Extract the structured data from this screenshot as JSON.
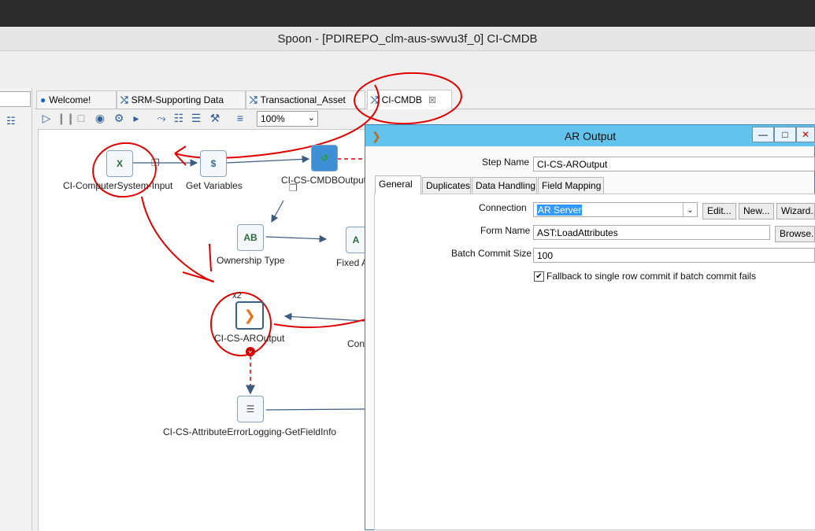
{
  "window": {
    "title": "Spoon - [PDIREPO_clm-aus-swvu3f_0] CI-CMDB"
  },
  "tabs": [
    {
      "label": "Welcome!",
      "active": false
    },
    {
      "label": "SRM-Supporting Data",
      "active": false
    },
    {
      "label": "Transactional_Asset",
      "active": false
    },
    {
      "label": "CI-CMDB",
      "active": true
    }
  ],
  "toolbar": {
    "zoom": "100%"
  },
  "nodes": {
    "input": {
      "label": "CI-ComputerSystem-Input",
      "icon": "excel-input-icon"
    },
    "getvars": {
      "label": "Get Variables",
      "icon": "dollar-icon"
    },
    "cmdboutput": {
      "label": "CI-CS-CMDBOutput",
      "icon": "database-output-icon"
    },
    "ownership": {
      "label": "Ownership Type",
      "icon": "value-mapper-icon"
    },
    "fixed": {
      "label": "Fixed A",
      "icon": "value-mapper-icon"
    },
    "aroutput": {
      "label": "CI-CS-AROutput",
      "icon": "ar-output-icon",
      "copies": "x2"
    },
    "con": {
      "label": "Con"
    },
    "errorlog": {
      "label": "CI-CS-AttributeErrorLogging-GetFieldInfo",
      "icon": "text-file-icon"
    }
  },
  "dialog": {
    "title": "AR Output",
    "step_name_label": "Step Name",
    "step_name": "CI-CS-AROutput",
    "tabs": [
      "General",
      "Duplicates",
      "Data Handling",
      "Field Mapping"
    ],
    "connection_label": "Connection",
    "connection": "AR Server",
    "edit": "Edit...",
    "new": "New...",
    "wizard": "Wizard...",
    "form_name_label": "Form Name",
    "form_name": "AST:LoadAttributes",
    "browse": "Browse...",
    "batch_label": "Batch Commit Size",
    "batch": "100",
    "fallback_label": "Fallback to single row commit if batch commit fails",
    "fallback_checked": true
  },
  "colors": {
    "dialog_title": "#62c3ec",
    "annotation": "#e00000",
    "hop": "#3d5a80"
  }
}
